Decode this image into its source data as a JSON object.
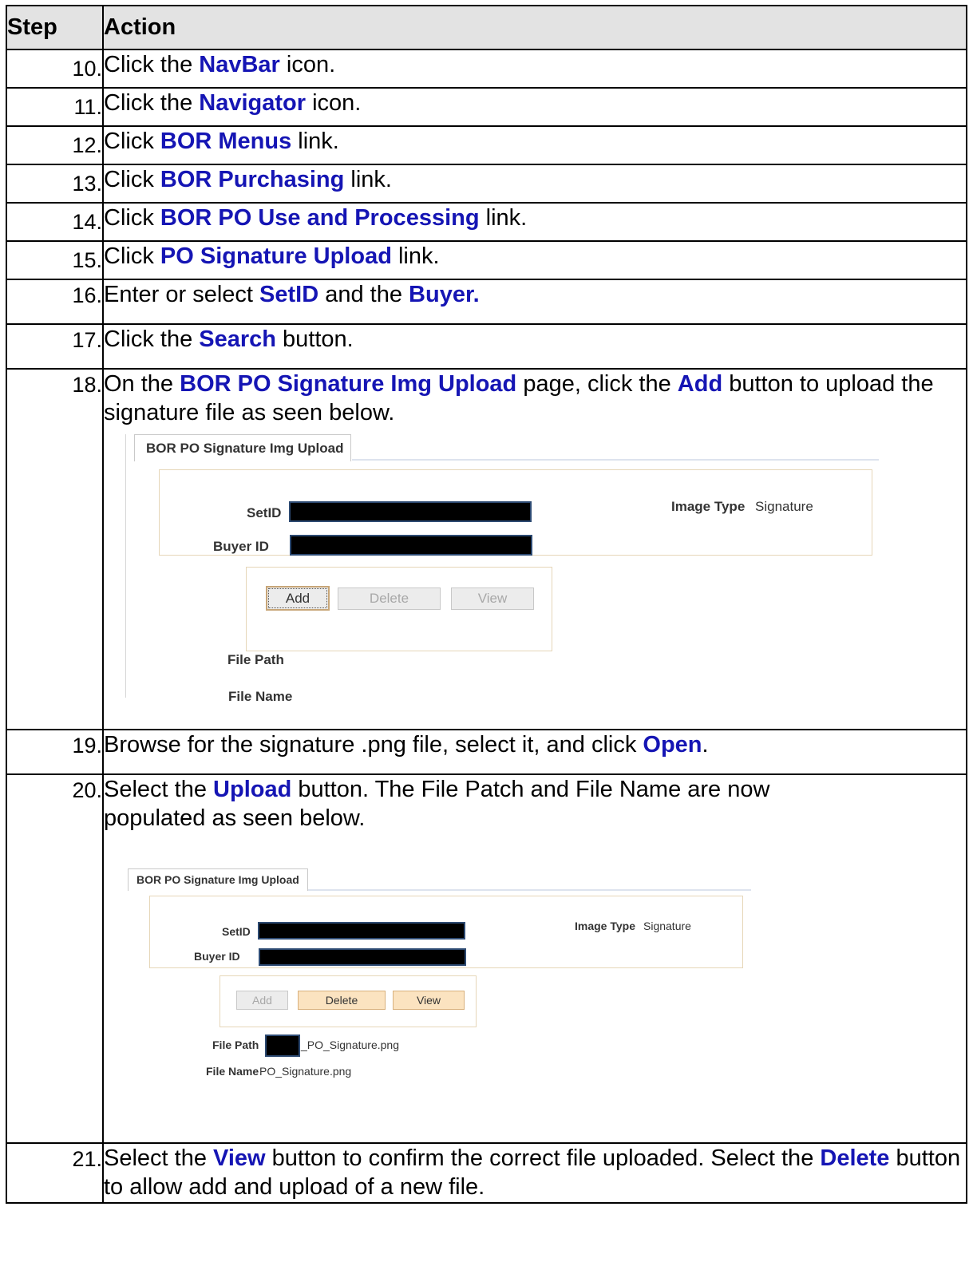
{
  "table": {
    "header_step": "Step",
    "header_action": "Action"
  },
  "steps": [
    {
      "num": "10.",
      "parts": [
        "Click the ",
        "NavBar",
        " icon."
      ]
    },
    {
      "num": "11.",
      "parts": [
        "Click the ",
        "Navigator",
        " icon."
      ]
    },
    {
      "num": "12.",
      "parts": [
        "Click ",
        "BOR Menus",
        " link."
      ]
    },
    {
      "num": "13.",
      "parts": [
        "Click ",
        "BOR Purchasing",
        " link."
      ]
    },
    {
      "num": "14.",
      "parts": [
        "Click ",
        "BOR PO Use and Processing",
        " link."
      ]
    },
    {
      "num": "15.",
      "parts": [
        "Click ",
        "PO Signature Upload",
        " link."
      ]
    },
    {
      "num": "16.",
      "parts": [
        "Enter or select ",
        "SetID",
        " and the ",
        "Buyer."
      ]
    },
    {
      "num": "17.",
      "parts": [
        "Click the ",
        "Search",
        " button."
      ]
    },
    {
      "num": "18.",
      "parts": [
        "On the ",
        "BOR PO Signature Img Upload",
        " page, click the ",
        "Add",
        " button to upload the signature file as seen below."
      ]
    },
    {
      "num": "19.",
      "parts": [
        "Browse for the signature .png file, select it, and click ",
        "Open",
        "."
      ]
    },
    {
      "num": "20.",
      "parts": [
        "Select the ",
        "Upload",
        " button. The File Patch and File Name are now populated as seen below."
      ]
    },
    {
      "num": "21.",
      "parts": [
        "Select the ",
        "View",
        " button to confirm the correct file uploaded. Select the ",
        "Delete",
        " button to allow add and upload of a new file."
      ]
    }
  ],
  "screenshot1": {
    "tab": "BOR PO Signature Img Upload",
    "setid_label": "SetID",
    "buyer_label": "Buyer ID",
    "image_type_label": "Image Type",
    "image_type_value": "Signature",
    "add_label": "Add",
    "delete_label": "Delete",
    "view_label": "View",
    "file_path_label": "File Path",
    "file_name_label": "File Name"
  },
  "screenshot2": {
    "tab": "BOR PO Signature Img Upload",
    "setid_label": "SetID",
    "buyer_label": "Buyer ID",
    "image_type_label": "Image Type",
    "image_type_value": "Signature",
    "add_label": "Add",
    "delete_label": "Delete",
    "view_label": "View",
    "file_path_label": "File Path",
    "file_path_value": "_PO_Signature.png",
    "file_name_label": "File Name",
    "file_name_value": "PO_Signature.png"
  },
  "colors": {
    "highlight": "#1515b4",
    "header_bg": "#e3e3e3",
    "active_button": "#fbe3c0"
  }
}
